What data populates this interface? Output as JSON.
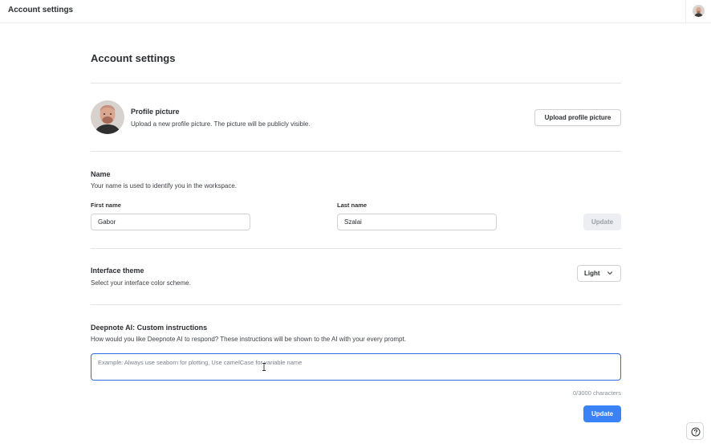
{
  "topbar": {
    "title": "Account settings",
    "avatar_icon": "user-avatar"
  },
  "page": {
    "title": "Account settings"
  },
  "profile_picture": {
    "title": "Profile picture",
    "description": "Upload a new profile picture. The picture will be publicly visible.",
    "upload_label": "Upload profile picture"
  },
  "name": {
    "title": "Name",
    "description": "Your name is used to identify you in the workspace.",
    "first_name_label": "First name",
    "first_name_value": "Gabor",
    "last_name_label": "Last name",
    "last_name_value": "Szalai",
    "update_label": "Update"
  },
  "theme": {
    "title": "Interface theme",
    "description": "Select your interface color scheme.",
    "selected": "Light"
  },
  "ai": {
    "title": "Deepnote AI: Custom instructions",
    "description": "How would you like Deepnote AI to respond? These instructions will be shown to the AI with your every prompt.",
    "placeholder": "Example: Always use seaborn for plotting, Use camelCase for variable name",
    "char_count": "0/3000 characters",
    "update_label": "Update"
  },
  "colors": {
    "primary": "#3b82f6",
    "focus_border": "#2f6fe0",
    "disabled_bg": "#eceef1"
  },
  "icons": {
    "theme_dropdown": "chevron-down-icon",
    "help": "question-icon",
    "cursor": "text-cursor-icon"
  }
}
